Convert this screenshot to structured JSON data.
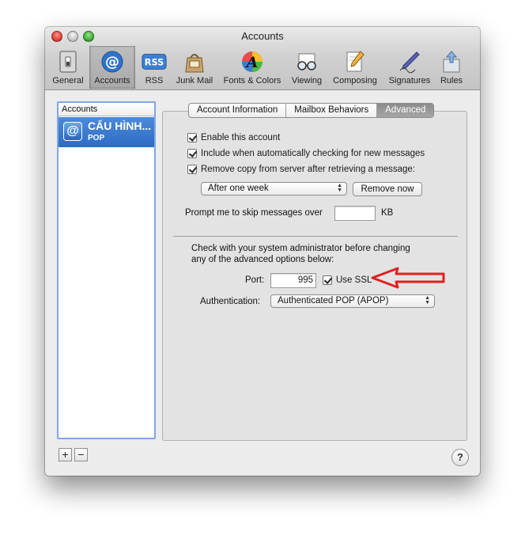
{
  "window": {
    "title": "Accounts"
  },
  "toolbar": {
    "items": [
      {
        "label": "General",
        "icon": "switch-icon"
      },
      {
        "label": "Accounts",
        "icon": "at-sign-icon"
      },
      {
        "label": "RSS",
        "icon": "rss-icon"
      },
      {
        "label": "Junk Mail",
        "icon": "junk-bag-icon"
      },
      {
        "label": "Fonts & Colors",
        "icon": "color-font-icon"
      },
      {
        "label": "Viewing",
        "icon": "glasses-icon"
      },
      {
        "label": "Composing",
        "icon": "pencil-paper-icon"
      },
      {
        "label": "Signatures",
        "icon": "pen-signature-icon"
      },
      {
        "label": "Rules",
        "icon": "arrows-rules-icon"
      }
    ]
  },
  "sidebar": {
    "header": "Accounts",
    "accounts": [
      {
        "name": "CẤU HÌNH...",
        "type": "POP"
      }
    ],
    "add_label": "+",
    "remove_label": "−"
  },
  "help": {
    "label": "?"
  },
  "tabs": [
    {
      "label": "Account Information"
    },
    {
      "label": "Mailbox Behaviors"
    },
    {
      "label": "Advanced"
    }
  ],
  "advanced": {
    "enable_label": "Enable this account",
    "include_label": "Include when automatically checking for new messages",
    "remove_copy_label": "Remove copy from server after retrieving a message:",
    "remove_period": "After one week",
    "remove_now_label": "Remove now",
    "prompt_label": "Prompt me to skip messages over",
    "prompt_value": "",
    "prompt_unit": "KB",
    "admin_note_line1": "Check with your system administrator before changing",
    "admin_note_line2": "any of the advanced options below:",
    "port_label": "Port:",
    "port_value": "995",
    "ssl_label": "Use SSL",
    "auth_label": "Authentication:",
    "auth_value": "Authenticated POP (APOP)"
  },
  "colors": {
    "annotation_arrow": "#e02020",
    "selection": "#2b6cc4"
  }
}
